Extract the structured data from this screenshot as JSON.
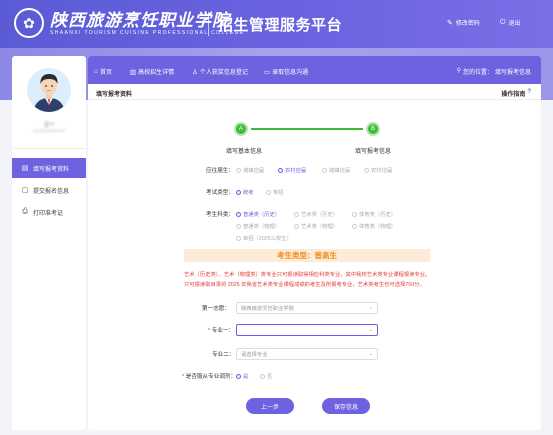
{
  "header": {
    "school_cn": "陕西旅游烹饪职业学院",
    "school_en": "SHAANXI TOURISM CUISINE PROFESSIONAL COLLEGE",
    "platform_title": "招生管理服务平台",
    "change_password": "修改密码",
    "logout": "退出"
  },
  "sidebar": {
    "user_name": "王**",
    "user_id": "**************",
    "items": [
      {
        "label": "填写报考资料",
        "icon": "edit-doc-icon",
        "active": true
      },
      {
        "label": "提交报名信息",
        "icon": "submit-doc-icon",
        "active": false
      },
      {
        "label": "打印准考证",
        "icon": "printer-icon",
        "active": false
      }
    ]
  },
  "topnav": {
    "items": [
      {
        "label": "首页",
        "icon": "home-icon"
      },
      {
        "label": "高校招生详情",
        "icon": "school-icon"
      },
      {
        "label": "个人获奖信息登记",
        "icon": "user-icon"
      },
      {
        "label": "录取信息沟通",
        "icon": "chat-icon"
      }
    ],
    "location_prefix": "您的位置：",
    "location_value": "填写报考信息"
  },
  "section": {
    "title": "填写报考资料",
    "guide": "操作指南",
    "guide_mark": "?"
  },
  "steps": [
    {
      "letter": "A",
      "label": "填写基本信息"
    },
    {
      "letter": "B",
      "label": "填写报考信息"
    }
  ],
  "form": {
    "fresh_label": "应往届生：",
    "fresh_options": [
      "城镇应届",
      "农村应届",
      "城镇往届",
      "农村往届"
    ],
    "fresh_selected": 1,
    "exam_type_label": "考试类型：",
    "exam_type_options": [
      "统考",
      "单招"
    ],
    "exam_type_selected": 0,
    "category_label": "考生科类：",
    "category_options": [
      "普通类（历史）",
      "艺术类（历史）",
      "体育类（历史）",
      "普通类（物理）",
      "艺术类（物理）",
      "体育类（物理）",
      "单招（2025三校生）"
    ],
    "category_selected": 0,
    "type_banner": "考生类型：普高生",
    "notice_line1": "艺术（历史类）、艺术（物理类）类专业只可报读取得相应科类专业，其中我校艺术类专业课程报读专业。",
    "notice_line2": "只可报读取目录的 2025 年我省艺术类专业课程成绩的考生及所报考专业，艺术类考生也可选择750分。",
    "choice1_label": "第一志愿：",
    "choice1_value": "陕西旅游烹饪职业学院",
    "major1_label": "专业一：",
    "major1_required": "*",
    "major1_value": "",
    "major2_label": "专业二：",
    "major2_value": "请选择专业",
    "adjust_required": "*",
    "adjust_label": "是否服从专业调剂：",
    "adjust_options": [
      "是",
      "否"
    ],
    "adjust_selected": 0
  },
  "buttons": {
    "prev": "上一步",
    "save": "保存信息"
  }
}
